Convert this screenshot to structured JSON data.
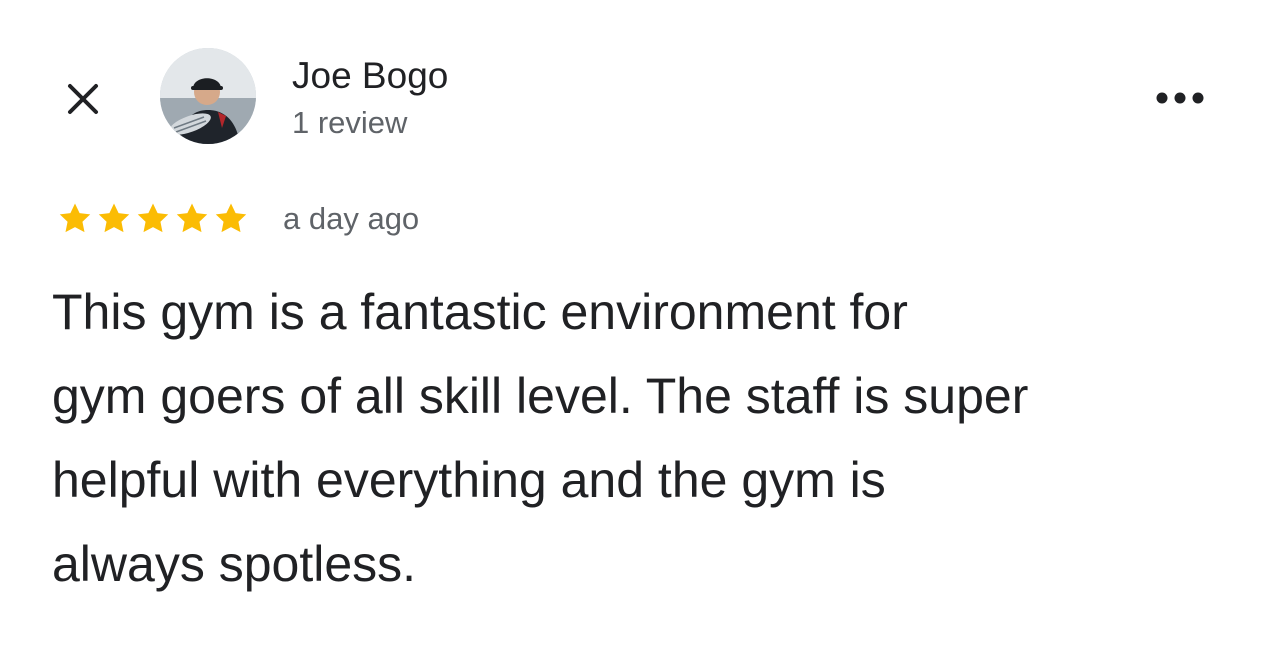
{
  "reviewer": {
    "name": "Joe Bogo",
    "review_count": "1 review",
    "avatar_icon": "user-photo-avatar"
  },
  "header": {
    "close_icon": "close-icon",
    "more_icon": "more-options-icon"
  },
  "review": {
    "rating": 5,
    "rating_max": 5,
    "date": "a day ago",
    "text_lines": [
      "This gym is a fantastic environment for",
      "gym goers of all skill level. The staff is super",
      "helpful with everything and the gym is",
      "always spotless."
    ]
  },
  "colors": {
    "star": "#FBBC04",
    "text_primary": "#202124",
    "text_secondary": "#5F6368"
  }
}
